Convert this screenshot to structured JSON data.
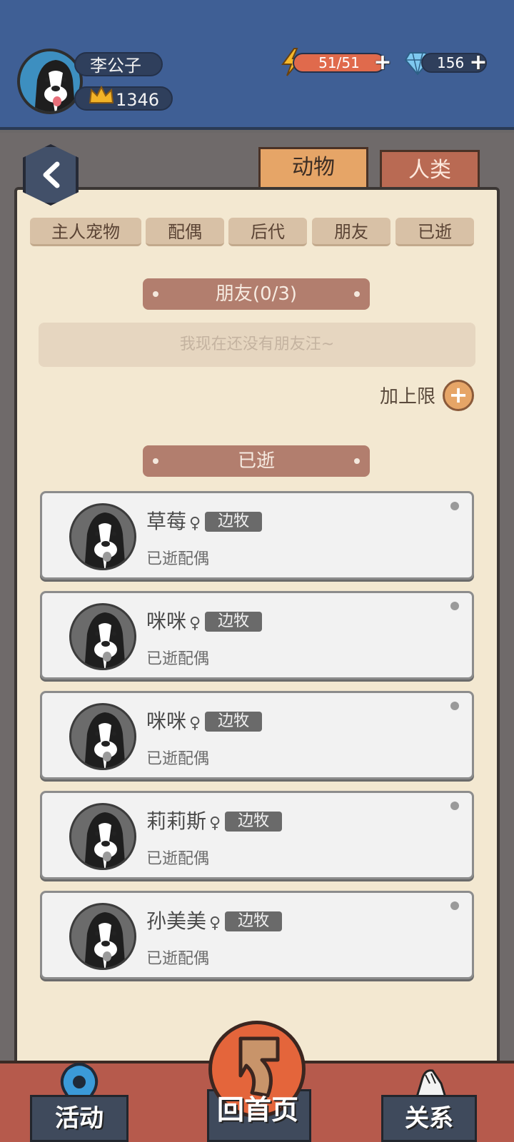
{
  "header": {
    "username": "李公子",
    "score": "1346",
    "energy_text": "51/51",
    "energy_fraction": 1.0,
    "gems": "156"
  },
  "main_tabs": [
    {
      "label": "动物",
      "active": true
    },
    {
      "label": "人类",
      "active": false
    }
  ],
  "sub_tabs": [
    "主人宠物",
    "配偶",
    "后代",
    "朋友",
    "已逝"
  ],
  "friends_section": {
    "header": "朋友(0/3)",
    "empty_message": "我现在还没有朋友汪~",
    "add_limit_label": "加上限"
  },
  "deceased_section": {
    "header": "已逝",
    "pets": [
      {
        "name": "草莓",
        "gender": "♀",
        "breed": "边牧",
        "status": "已逝配偶"
      },
      {
        "name": "咪咪",
        "gender": "♀",
        "breed": "边牧",
        "status": "已逝配偶"
      },
      {
        "name": "咪咪",
        "gender": "♀",
        "breed": "边牧",
        "status": "已逝配偶"
      },
      {
        "name": "莉莉斯",
        "gender": "♀",
        "breed": "边牧",
        "status": "已逝配偶"
      },
      {
        "name": "孙美美",
        "gender": "♀",
        "breed": "边牧",
        "status": "已逝配偶"
      }
    ]
  },
  "bottom_nav": {
    "activity": "活动",
    "home": "回首页",
    "relation": "关系"
  },
  "colors": {
    "topbar": "#3f5f95",
    "paper": "#f3e8d1",
    "accent_orange": "#e6a567",
    "header_brown": "#b27e6e"
  }
}
